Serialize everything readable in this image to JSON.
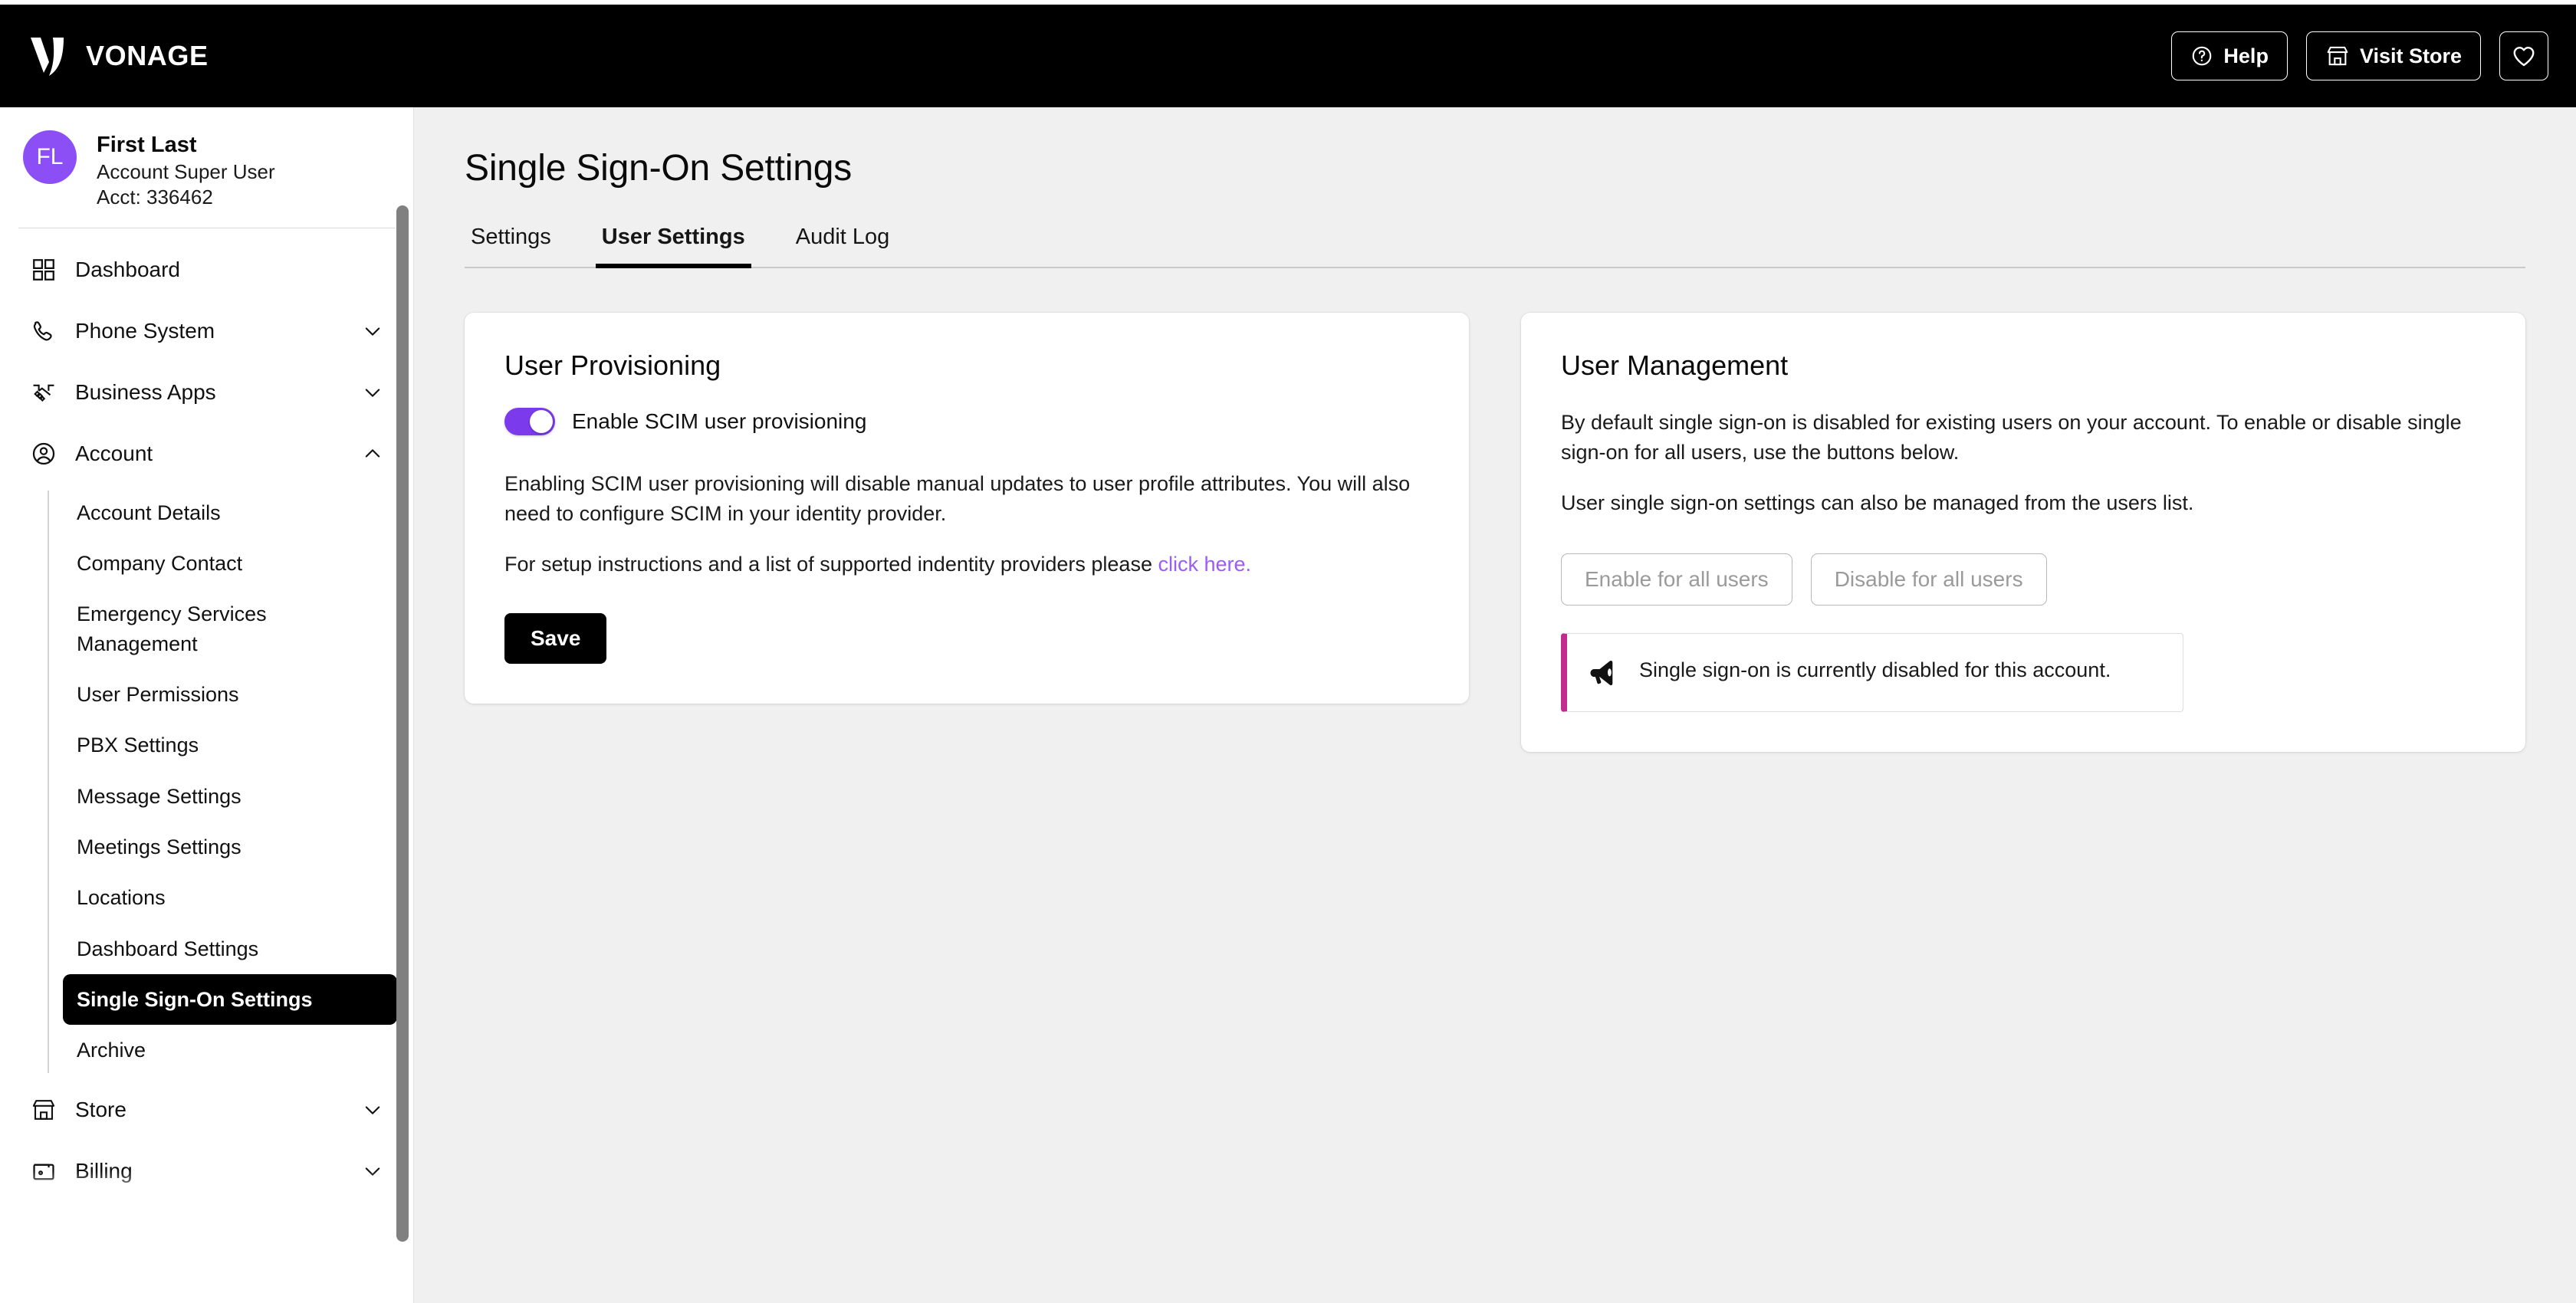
{
  "topbar": {
    "brand": "VONAGE",
    "help_label": "Help",
    "visit_store_label": "Visit Store"
  },
  "sidebar": {
    "profile": {
      "initials": "FL",
      "name": "First Last",
      "role": "Account Super User",
      "account": "Acct: 336462"
    },
    "nav": [
      {
        "label": "Dashboard",
        "icon": "grid-icon",
        "chevron": ""
      },
      {
        "label": "Phone System",
        "icon": "phone-icon",
        "chevron": "down"
      },
      {
        "label": "Business Apps",
        "icon": "handshake-icon",
        "chevron": "down"
      },
      {
        "label": "Account",
        "icon": "user-circle-icon",
        "chevron": "up"
      }
    ],
    "account_submenu": [
      {
        "label": "Account Details",
        "active": false
      },
      {
        "label": "Company Contact",
        "active": false
      },
      {
        "label": "Emergency Services Management",
        "active": false
      },
      {
        "label": "User Permissions",
        "active": false
      },
      {
        "label": "PBX Settings",
        "active": false
      },
      {
        "label": "Message Settings",
        "active": false
      },
      {
        "label": "Meetings Settings",
        "active": false
      },
      {
        "label": "Locations",
        "active": false
      },
      {
        "label": "Dashboard Settings",
        "active": false
      },
      {
        "label": "Single Sign-On Settings",
        "active": true
      },
      {
        "label": "Archive",
        "active": false
      }
    ],
    "nav_bottom": [
      {
        "label": "Store",
        "icon": "store-icon",
        "chevron": "down"
      },
      {
        "label": "Billing",
        "icon": "wallet-icon",
        "chevron": "down"
      }
    ]
  },
  "main": {
    "page_title": "Single Sign-On Settings",
    "tabs": [
      {
        "label": "Settings",
        "active": false
      },
      {
        "label": "User Settings",
        "active": true
      },
      {
        "label": "Audit Log",
        "active": false
      }
    ],
    "provisioning": {
      "title": "User Provisioning",
      "toggle_label": "Enable SCIM user provisioning",
      "toggle_on": true,
      "paragraph1": "Enabling SCIM user provisioning will disable manual updates to user profile attributes. You will also need to configure SCIM in your identity provider.",
      "paragraph2_prefix": "For setup instructions and a list of supported indentity providers please ",
      "paragraph2_link": "click here.",
      "save_label": "Save"
    },
    "management": {
      "title": "User Management",
      "paragraph1": "By default single sign-on is disabled for existing users on your account. To enable or disable single sign-on for all users, use the buttons below.",
      "paragraph2": "User single sign-on settings can also be managed from the users list.",
      "enable_all_label": "Enable for all users",
      "disable_all_label": "Disable for all users",
      "alert_text": "Single sign-on is currently disabled for this account."
    }
  },
  "colors": {
    "brand_black": "#000000",
    "accent_purple": "#7C3AED",
    "avatar_purple": "#8B4FF5",
    "link_purple": "#9B5CF6",
    "alert_magenta": "#C42B8F",
    "page_background": "#F1F0F0"
  }
}
